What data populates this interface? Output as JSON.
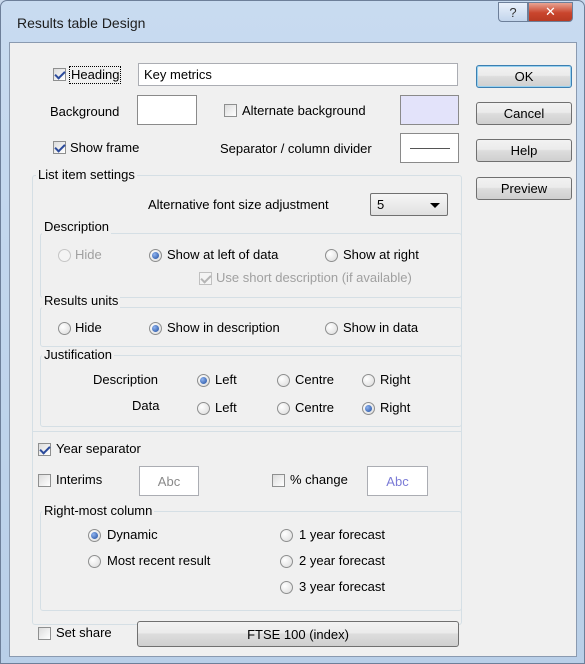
{
  "window": {
    "title": "Results table Design",
    "help_glyph": "?",
    "close_glyph": "✕"
  },
  "heading": {
    "label": "Heading",
    "checked": true,
    "value": "Key metrics"
  },
  "background": {
    "label": "Background",
    "color": "#ffffff"
  },
  "alternate_background": {
    "label": "Alternate background",
    "checked": false,
    "color": "#e3e3fa"
  },
  "show_frame": {
    "label": "Show frame",
    "checked": true
  },
  "separator": {
    "label": "Separator / column divider"
  },
  "buttons": {
    "ok": "OK",
    "cancel": "Cancel",
    "help": "Help",
    "preview": "Preview"
  },
  "list_item_settings": {
    "label": "List item settings",
    "font_adjust_label": "Alternative font size adjustment",
    "font_adjust_value": "5"
  },
  "description": {
    "label": "Description",
    "options": [
      "Hide",
      "Show at left of data",
      "Show at right"
    ],
    "selected": "Show at left of data",
    "short_label": "Use short description (if available)"
  },
  "results_units": {
    "label": "Results units",
    "options": [
      "Hide",
      "Show in description",
      "Show in data"
    ],
    "selected": "Show in description"
  },
  "justification": {
    "label": "Justification",
    "rows": [
      {
        "label": "Description",
        "options": [
          "Left",
          "Centre",
          "Right"
        ],
        "selected": "Left"
      },
      {
        "label": "Data",
        "options": [
          "Left",
          "Centre",
          "Right"
        ],
        "selected": "Right"
      }
    ]
  },
  "year_separator": {
    "label": "Year separator",
    "checked": true
  },
  "interims": {
    "label": "Interims",
    "checked": false,
    "sample": "Abc"
  },
  "pct_change": {
    "label": "% change",
    "checked": false,
    "sample": "Abc"
  },
  "right_most_column": {
    "label": "Right-most column",
    "options": [
      "Dynamic",
      "Most recent result",
      "1 year forecast",
      "2 year forecast",
      "3 year forecast"
    ],
    "selected": "Dynamic"
  },
  "set_share": {
    "label": "Set share",
    "checked": false,
    "button": "FTSE 100 (index)"
  }
}
